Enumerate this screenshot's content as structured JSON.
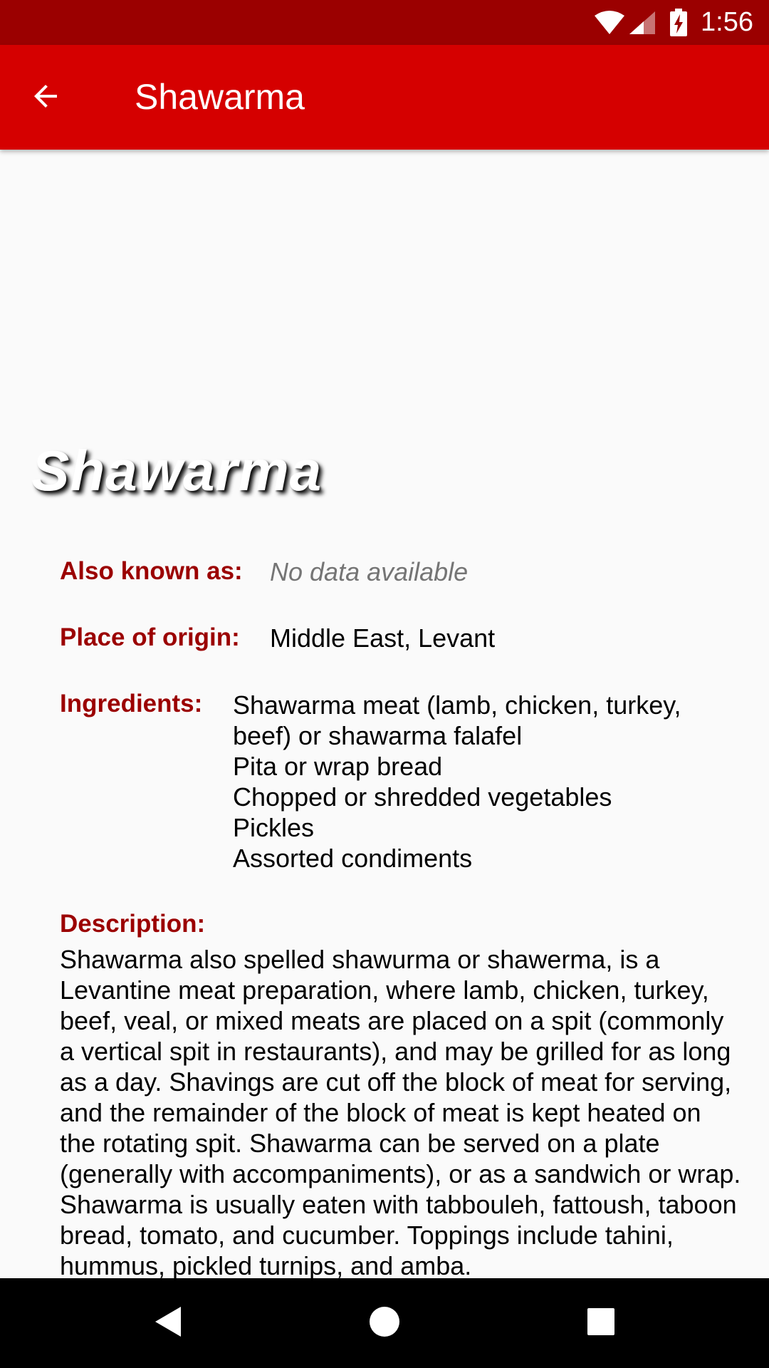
{
  "status_bar": {
    "time": "1:56",
    "icons": [
      "wifi-icon",
      "cell-signal-icon",
      "battery-charging-icon"
    ]
  },
  "app_bar": {
    "back_icon": "arrow-back-icon",
    "title": "Shawarma"
  },
  "hero": {
    "title": "Shawarma"
  },
  "details": {
    "also_known_as": {
      "label": "Also known as:",
      "value": "No data available"
    },
    "place_of_origin": {
      "label": "Place of origin:",
      "value": "Middle East, Levant"
    },
    "ingredients": {
      "label": "Ingredients:",
      "items": [
        "Shawarma meat (lamb, chicken, turkey,",
        "beef) or shawarma falafel",
        "Pita or wrap bread",
        "Chopped or shredded vegetables",
        "Pickles",
        "Assorted condiments"
      ]
    },
    "description": {
      "label": "Description:",
      "text": "Shawarma also spelled shawurma or shawerma, is a Levantine meat preparation, where lamb, chicken, turkey, beef, veal, or mixed meats are placed on a spit (commonly a vertical spit in restaurants), and may be grilled for as long as a day. Shavings are cut off the block of meat for serving, and the remainder of the block of meat is kept heated on the rotating spit. Shawarma can be served on a plate (generally with accompaniments), or as a sandwich or wrap. Shawarma is usually eaten with tabbouleh, fattoush, taboon bread, tomato, and cucumber. Toppings include tahini, hummus, pickled turnips, and amba."
    }
  },
  "nav_bar": {
    "buttons": [
      "back-triangle-icon",
      "home-circle-icon",
      "recents-square-icon"
    ]
  },
  "colors": {
    "status_bar": "#9b0000",
    "app_bar": "#d50000",
    "label": "#9b0000",
    "muted_value": "#757575",
    "background": "#fafafa"
  }
}
